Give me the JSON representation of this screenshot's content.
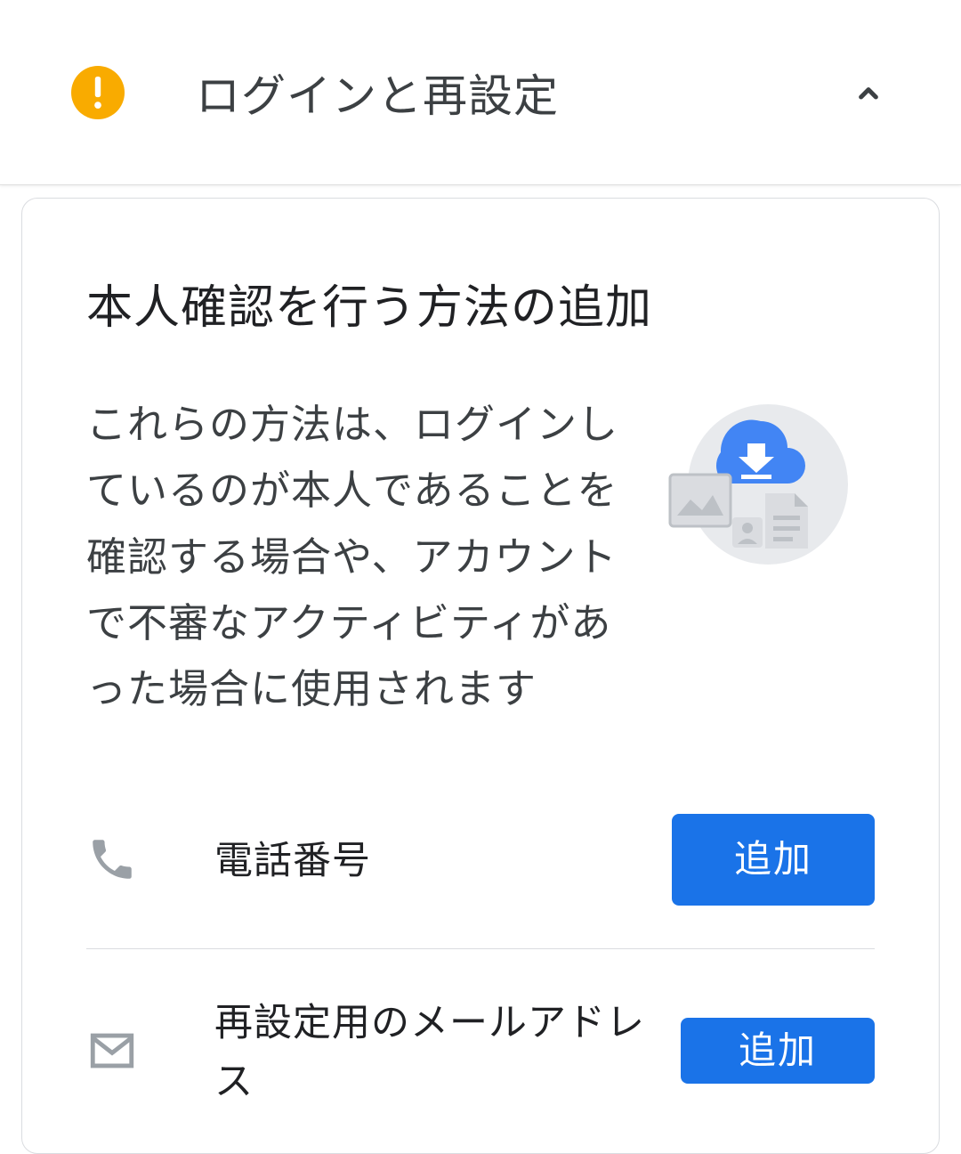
{
  "header": {
    "title": "ログインと再設定"
  },
  "card": {
    "title": "本人確認を行う方法の追加",
    "description": "これらの方法は、ログインしているのが本人であることを確認する場合や、アカウントで不審なアクティビティがあった場合に使用されます"
  },
  "options": {
    "phone": {
      "label": "電話番号",
      "button": "追加"
    },
    "email": {
      "label": "再設定用のメールアドレス",
      "button": "追加"
    }
  },
  "colors": {
    "warning": "#f9ab00",
    "primary": "#1a73e8"
  }
}
